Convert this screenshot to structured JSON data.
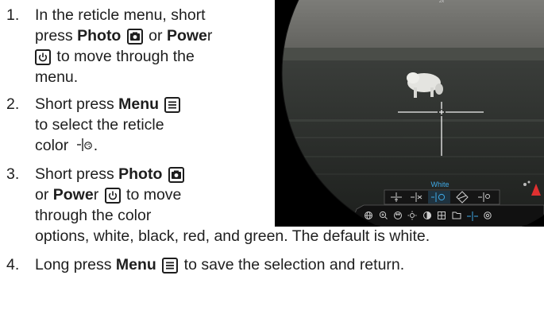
{
  "steps": [
    {
      "num": "1.",
      "line1": "In the reticle menu, short",
      "line2_a": "press ",
      "line2_photo": "Photo",
      "line2_b": " or ",
      "line2_power": "Powe",
      "line2_power_r": "r",
      "line3": " to move through the",
      "line4": "menu."
    },
    {
      "num": "2.",
      "line1_a": "Short press ",
      "line1_menu": "Menu",
      "line2": "to select the reticle",
      "line3": "color ",
      "line3_end": "."
    },
    {
      "num": "3.",
      "line1_a": "Short press ",
      "line1_photo": "Photo",
      "line2_a": "or ",
      "line2_power": "Powe",
      "line2_r": "r",
      "line2_b": " to move",
      "line3": "through the color",
      "line4": "options, white, black, red, and green. The default is white."
    },
    {
      "num": "4.",
      "line1_a": "Long press ",
      "line1_menu": "Menu",
      "line1_b": " to save the selection and return."
    }
  ],
  "screen": {
    "color_label": "White",
    "top_readout": "2x",
    "colors": {
      "label_blue": "#3fa9e6",
      "selected_icon": "#3fa9e6",
      "icon_grey": "#cfcfcf"
    },
    "reticle_icons": [
      "reticle-1-icon",
      "reticle-2-icon",
      "reticle-color-icon",
      "reticle-4-icon",
      "reticle-5-icon"
    ],
    "menu_icons": [
      "globe-icon",
      "zoom-icon",
      "palette-icon",
      "brightness-icon",
      "contrast-icon",
      "picture-icon",
      "folder-icon",
      "reticle-icon",
      "settings-icon"
    ]
  }
}
